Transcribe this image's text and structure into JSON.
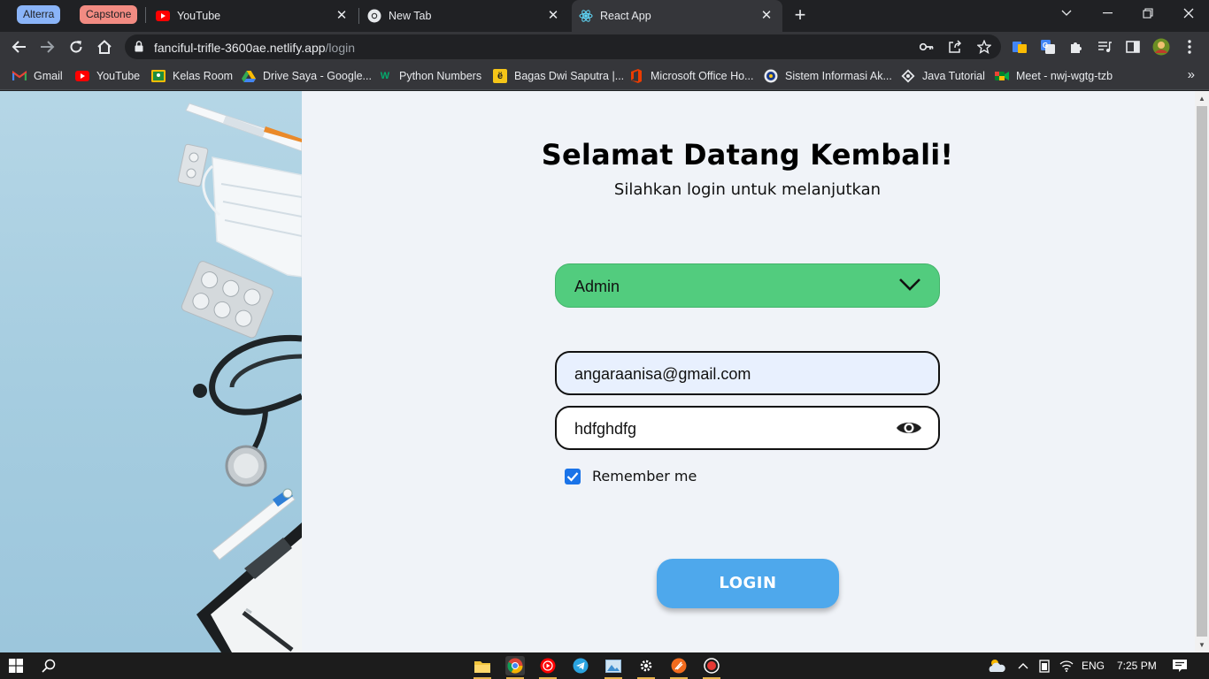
{
  "browser": {
    "tab_groups": [
      {
        "label": "Alterra",
        "color": "#8ab4f8"
      },
      {
        "label": "Capstone",
        "color": "#f28b82"
      }
    ],
    "tabs": [
      {
        "title": "YouTube",
        "icon": "youtube-icon",
        "active": false
      },
      {
        "title": "New Tab",
        "icon": "chrome-icon",
        "active": false
      },
      {
        "title": "React App",
        "icon": "react-icon",
        "active": true
      }
    ],
    "url": {
      "host": "fanciful-trifle-3600ae.netlify.app",
      "path": "/login"
    },
    "bookmarks": [
      {
        "label": "Gmail",
        "icon": "gmail-icon"
      },
      {
        "label": "YouTube",
        "icon": "youtube-icon"
      },
      {
        "label": "Kelas Room",
        "icon": "classroom-icon"
      },
      {
        "label": "Drive Saya - Google...",
        "icon": "drive-icon"
      },
      {
        "label": "Python Numbers",
        "icon": "w3schools-icon"
      },
      {
        "label": "Bagas Dwi Saputra |...",
        "icon": "e-icon"
      },
      {
        "label": "Microsoft Office Ho...",
        "icon": "office-icon"
      },
      {
        "label": "Sistem Informasi Ak...",
        "icon": "university-icon"
      },
      {
        "label": "Java Tutorial",
        "icon": "java-icon"
      },
      {
        "label": "Meet - nwj-wgtg-tzb",
        "icon": "meet-icon"
      }
    ]
  },
  "login": {
    "title": "Selamat Datang Kembali!",
    "subtitle": "Silahkan login untuk melanjutkan",
    "role_selected": "Admin",
    "email_value": "angaraanisa@gmail.com",
    "password_value": "hdfghdfg",
    "remember_label": "Remember me",
    "remember_checked": true,
    "login_button": "LOGIN",
    "colors": {
      "select_bg": "#52cc7e",
      "button_bg": "#4ea8ec",
      "page_bg": "#f0f3f8"
    }
  },
  "taskbar": {
    "language": "ENG",
    "time": "7:25 PM"
  }
}
